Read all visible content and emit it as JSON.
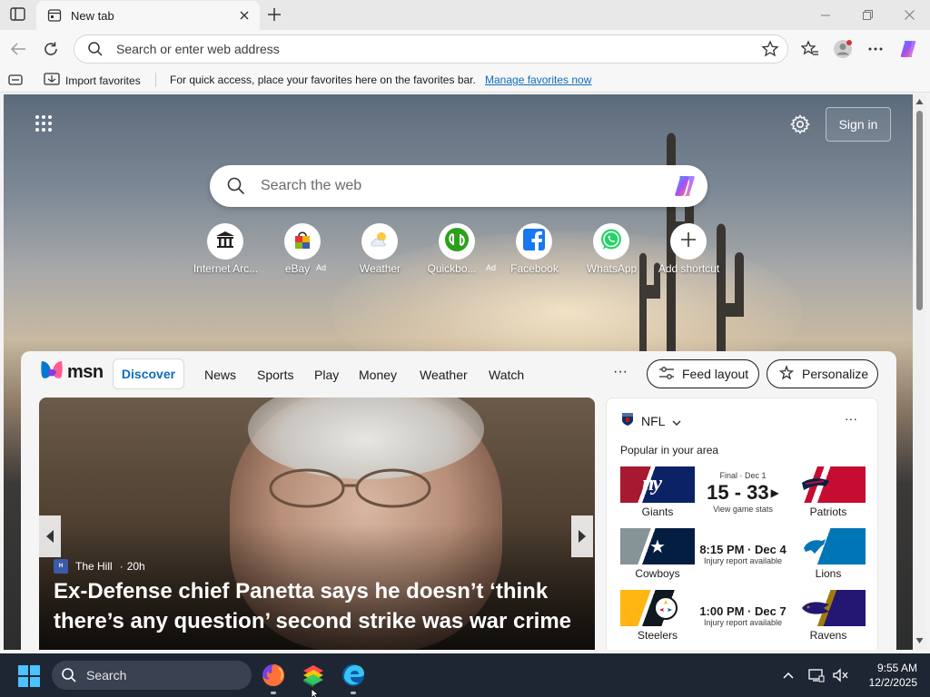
{
  "browser": {
    "tab_title": "New tab",
    "address_placeholder": "Search or enter web address"
  },
  "favorites_bar": {
    "import_label": "Import favorites",
    "message": "For quick access, place your favorites here on the favorites bar.",
    "manage_link": "Manage favorites now"
  },
  "newtab": {
    "sign_in_label": "Sign in",
    "search_placeholder": "Search the web",
    "shortcuts": [
      {
        "label": "Internet Arc...",
        "ad": "",
        "icon": "bank-building-icon"
      },
      {
        "label": "eBay",
        "ad": "Ad",
        "icon": "ebay-bag-icon"
      },
      {
        "label": "Weather",
        "ad": "",
        "icon": "weather-cloud-icon"
      },
      {
        "label": "Quickbo...",
        "ad": "Ad",
        "icon": "quickbooks-icon"
      },
      {
        "label": "Facebook",
        "ad": "",
        "icon": "facebook-icon"
      },
      {
        "label": "WhatsApp",
        "ad": "",
        "icon": "whatsapp-icon"
      },
      {
        "label": "Add shortcut",
        "ad": "",
        "icon": "plus-icon"
      }
    ]
  },
  "msn": {
    "logo_text": "msn",
    "nav": [
      "Discover",
      "News",
      "Sports",
      "Play",
      "Money",
      "Weather",
      "Watch"
    ],
    "more": "···",
    "feed_layout_label": "Feed layout",
    "personalize_label": "Personalize"
  },
  "hero": {
    "source": "The Hill",
    "age": "20h",
    "source_separator": "·",
    "headline": "Ex-Defense chief Panetta says he doesn’t ‘think there’s any question’ second strike was war crime"
  },
  "nfl": {
    "title": "NFL",
    "subtitle": "Popular in your area",
    "more": "···",
    "games": [
      {
        "home": "Giants",
        "away": "Patriots",
        "status": "Final · Dec 1",
        "score": "15 - 33",
        "sub": "View game stats",
        "time": "",
        "home_logo": "ny",
        "home_color": "#0b2265",
        "home_accent": "#a71930",
        "away_color": "#c60c30",
        "away_accent": "#002244"
      },
      {
        "home": "Cowboys",
        "away": "Lions",
        "status": "",
        "score": "",
        "sub": "Injury report available",
        "time": "8:15 PM · Dec 4",
        "home_logo": "★",
        "home_color": "#041e42",
        "home_accent": "#869397",
        "away_color": "#0076b6",
        "away_accent": "#b0b7bc"
      },
      {
        "home": "Steelers",
        "away": "Ravens",
        "status": "",
        "score": "",
        "sub": "Injury report available",
        "time": "1:00 PM · Dec 7",
        "home_logo": "◉",
        "home_color": "#101820",
        "home_accent": "#ffb612",
        "away_color": "#241773",
        "away_accent": "#9e7c0c"
      }
    ]
  },
  "taskbar": {
    "search_label": "Search",
    "time": "9:55 AM",
    "date": "12/2/2025"
  },
  "colors": {
    "accent_blue": "#0f6cbd",
    "taskbar_bg": "#1f2633"
  }
}
